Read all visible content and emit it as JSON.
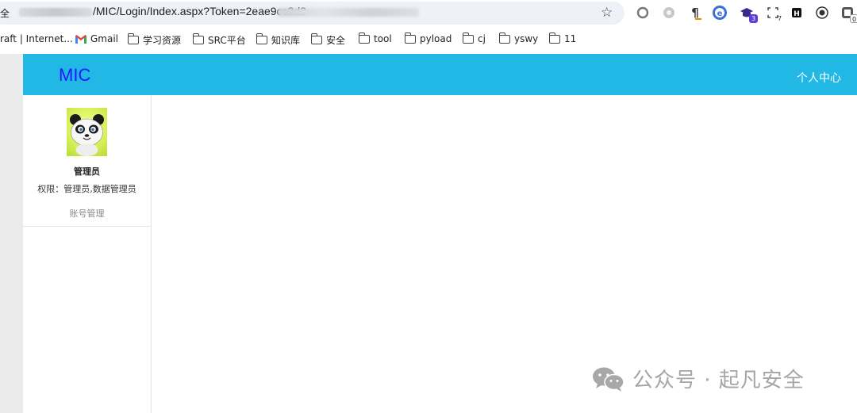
{
  "browser": {
    "address_prefix": "全",
    "url_visible": "/MIC/Login/Index.aspx?Token=2eae9cc2d2",
    "bookmarks": [
      {
        "label": "raft | Internet...",
        "icon": "none"
      },
      {
        "label": "Gmail",
        "icon": "gmail-icon"
      },
      {
        "label": "学习资源",
        "icon": "folder-icon"
      },
      {
        "label": "SRC平台",
        "icon": "folder-icon"
      },
      {
        "label": "知识库",
        "icon": "folder-icon"
      },
      {
        "label": "安全",
        "icon": "folder-icon"
      },
      {
        "label": "tool",
        "icon": "folder-icon"
      },
      {
        "label": "pyload",
        "icon": "folder-icon"
      },
      {
        "label": "cj",
        "icon": "folder-icon"
      },
      {
        "label": "yswy",
        "icon": "folder-icon"
      },
      {
        "label": "11",
        "icon": "folder-icon"
      }
    ],
    "extension_badges": {
      "ext4": "3",
      "ext5": "7",
      "ext8": "0"
    }
  },
  "app": {
    "brand": "MIC",
    "user_center": "个人中心",
    "profile": {
      "name": "管理员",
      "permissions": "权限：管理员,数据管理员",
      "account_link": "账号管理"
    }
  },
  "watermark": {
    "text": "公众号 · 起凡安全"
  },
  "colors": {
    "header": "#21b8e6",
    "brand": "#1a1aff",
    "gutter": "#ebebeb"
  }
}
